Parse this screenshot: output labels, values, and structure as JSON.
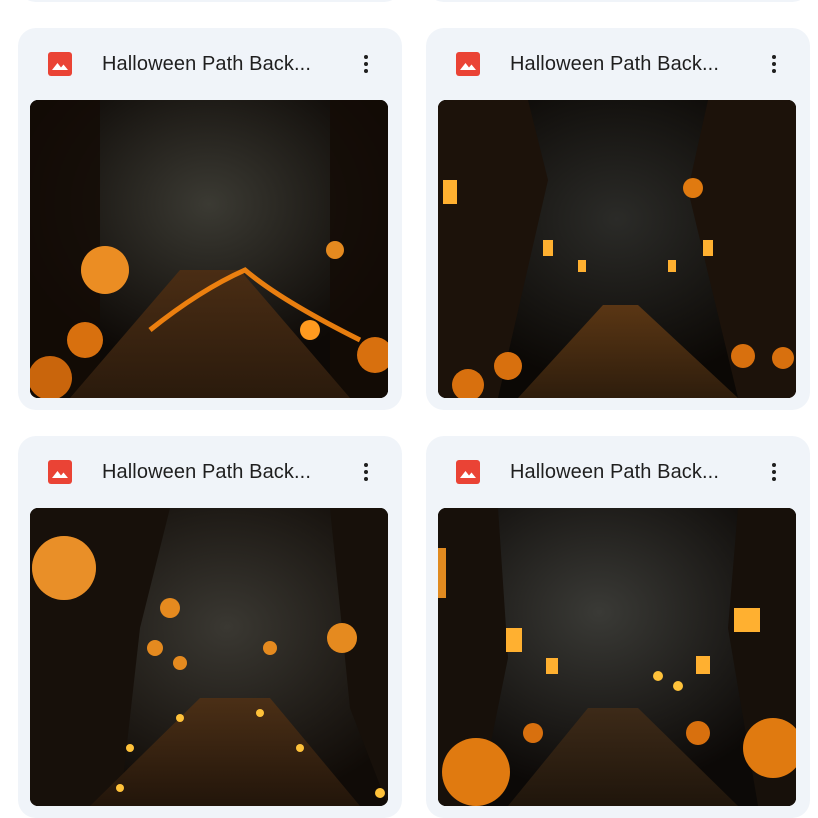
{
  "files": [
    {
      "title": "Halloween Path Back...",
      "icon": "image-file-icon",
      "menu_icon": "more-vert-icon"
    },
    {
      "title": "Halloween Path Back...",
      "icon": "image-file-icon",
      "menu_icon": "more-vert-icon"
    },
    {
      "title": "Halloween Path Back...",
      "icon": "image-file-icon",
      "menu_icon": "more-vert-icon"
    },
    {
      "title": "Halloween Path Back...",
      "icon": "image-file-icon",
      "menu_icon": "more-vert-icon"
    }
  ],
  "colors": {
    "card_bg": "#f0f4f9",
    "image_icon_red": "#ea4335",
    "title_text": "#1f1f1f",
    "glow_orange": "#ff9a1f"
  }
}
